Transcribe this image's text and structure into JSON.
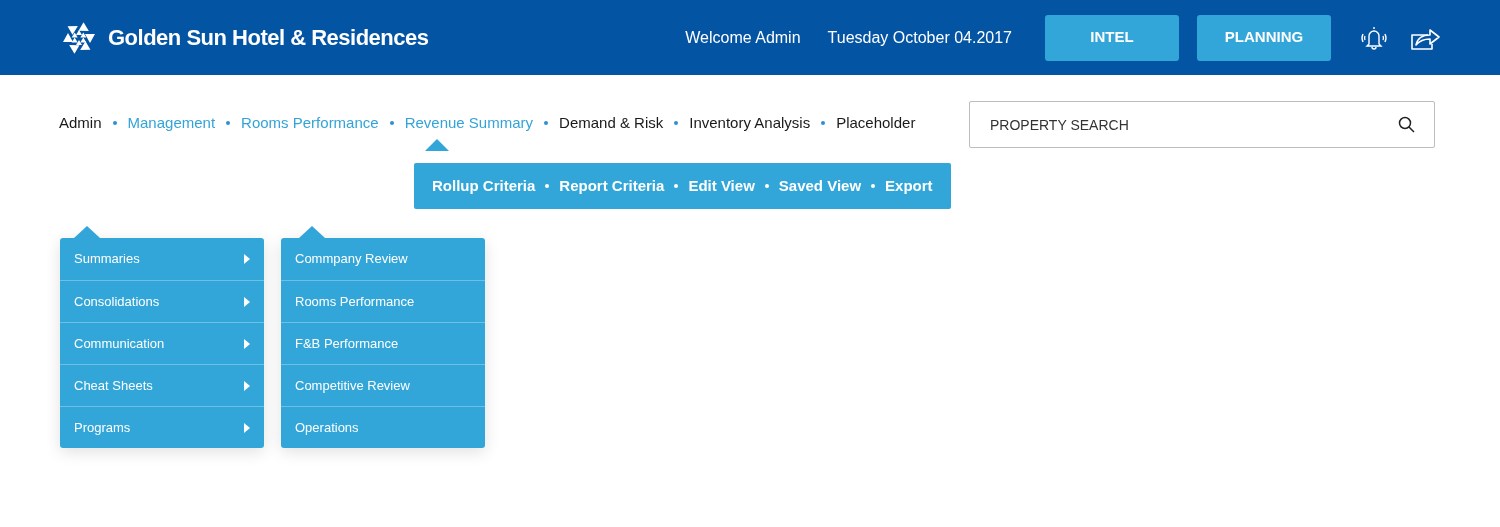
{
  "header": {
    "title": "Golden Sun Hotel & Residences",
    "welcome": "Welcome Admin",
    "date": "Tuesday October 04.2017",
    "buttons": [
      "INTEL",
      "PLANNING"
    ]
  },
  "nav": [
    {
      "label": "Admin",
      "highlighted": false,
      "selected": false
    },
    {
      "label": "Management",
      "highlighted": true,
      "selected": false
    },
    {
      "label": "Rooms Performance",
      "highlighted": true,
      "selected": false
    },
    {
      "label": "Revenue Summary",
      "highlighted": true,
      "selected": true
    },
    {
      "label": "Demand & Risk",
      "highlighted": false,
      "selected": false
    },
    {
      "label": "Inventory Analysis",
      "highlighted": false,
      "selected": false
    },
    {
      "label": "Placeholder",
      "highlighted": false,
      "selected": false
    }
  ],
  "search": {
    "placeholder": "PROPERTY SEARCH"
  },
  "subnav": [
    "Rollup Criteria",
    "Report Criteria",
    "Edit View",
    "Saved View",
    "Export"
  ],
  "menu": [
    {
      "label": "Summaries",
      "has_submenu": true
    },
    {
      "label": "Consolidations",
      "has_submenu": true
    },
    {
      "label": "Communication",
      "has_submenu": true
    },
    {
      "label": "Cheat Sheets",
      "has_submenu": true
    },
    {
      "label": "Programs",
      "has_submenu": true
    }
  ],
  "submenu": [
    {
      "label": "Commpany Review"
    },
    {
      "label": "Rooms Performance"
    },
    {
      "label": "F&B Performance"
    },
    {
      "label": "Competitive Review"
    },
    {
      "label": "Operations"
    }
  ]
}
